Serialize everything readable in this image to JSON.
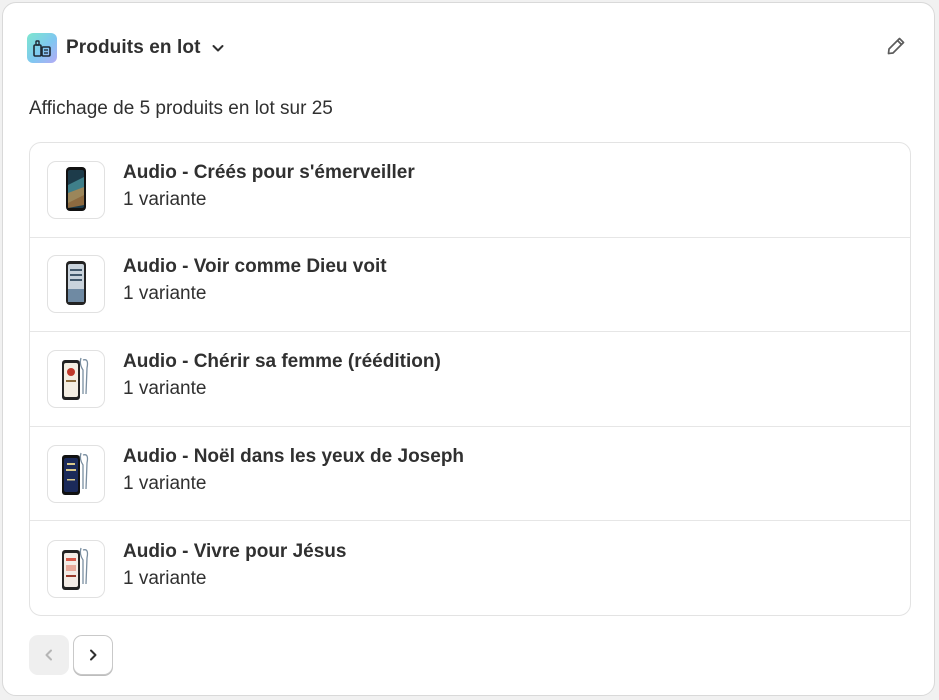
{
  "header": {
    "title": "Produits en lot",
    "app_icon": "bundle-app-icon",
    "dropdown_icon": "chevron-down-icon",
    "edit_icon": "pencil-icon"
  },
  "summary": "Affichage de 5 produits en lot sur 25",
  "products": [
    {
      "name": "Audio - Créés pour s'émerveiller",
      "variants": "1 variante",
      "thumb_colors": [
        "#1d3b4a",
        "#3f7f8a"
      ]
    },
    {
      "name": "Audio - Voir comme Dieu voit",
      "variants": "1 variante",
      "thumb_colors": [
        "#8aa3b8",
        "#d8dee4"
      ]
    },
    {
      "name": "Audio - Chérir sa femme (réédition)",
      "variants": "1 variante",
      "thumb_colors": [
        "#f4eee2",
        "#c0392b"
      ]
    },
    {
      "name": "Audio - Noël dans les yeux de Joseph",
      "variants": "1 variante",
      "thumb_colors": [
        "#1b2a5a",
        "#d9c98a"
      ]
    },
    {
      "name": "Audio - Vivre pour Jésus",
      "variants": "1 variante",
      "thumb_colors": [
        "#f3ece6",
        "#d65a4a"
      ]
    }
  ],
  "pagination": {
    "prev_icon": "chevron-left-icon",
    "next_icon": "chevron-right-icon",
    "prev_disabled": true
  }
}
